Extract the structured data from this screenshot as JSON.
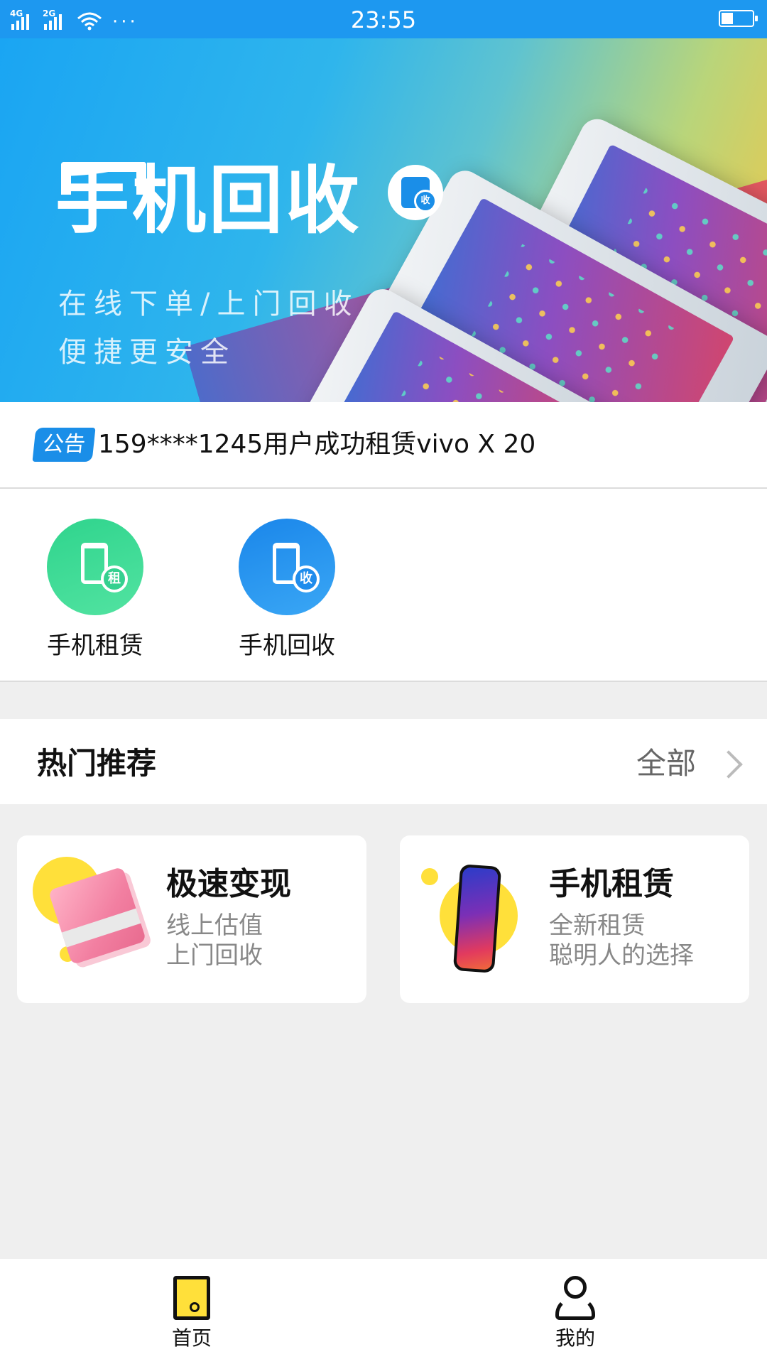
{
  "status_bar": {
    "sim1": "4G",
    "sim2": "2G",
    "more": "···",
    "time": "23:55"
  },
  "banner": {
    "title": "手机回收",
    "badge_text": "收",
    "line1": "在线下单/上门回收",
    "line2": "便捷更安全",
    "slides": 2,
    "active_slide": 2
  },
  "notice": {
    "tag": "公告",
    "text": "159****1245用户成功租赁vivo X 20"
  },
  "shortcuts": [
    {
      "label": "手机租赁",
      "badge": "租",
      "color": "#3fd793",
      "icon": "phone-rent-icon"
    },
    {
      "label": "手机回收",
      "badge": "收",
      "color": "#1f8cec",
      "icon": "phone-recycle-icon"
    }
  ],
  "hot": {
    "title": "热门推荐",
    "all_label": "全部"
  },
  "cards": [
    {
      "title": "极速变现",
      "sub1": "线上估值",
      "sub2": "上门回收",
      "icon": "cash-stack-icon"
    },
    {
      "title": "手机租赁",
      "sub1": "全新租赁",
      "sub2": "聪明人的选择",
      "icon": "smartphone-icon"
    }
  ],
  "tabbar": {
    "home": "首页",
    "mine": "我的",
    "active": "home"
  },
  "colors": {
    "primary": "#1d98f0",
    "accent_yellow": "#ffe03a",
    "green": "#3fd793"
  }
}
